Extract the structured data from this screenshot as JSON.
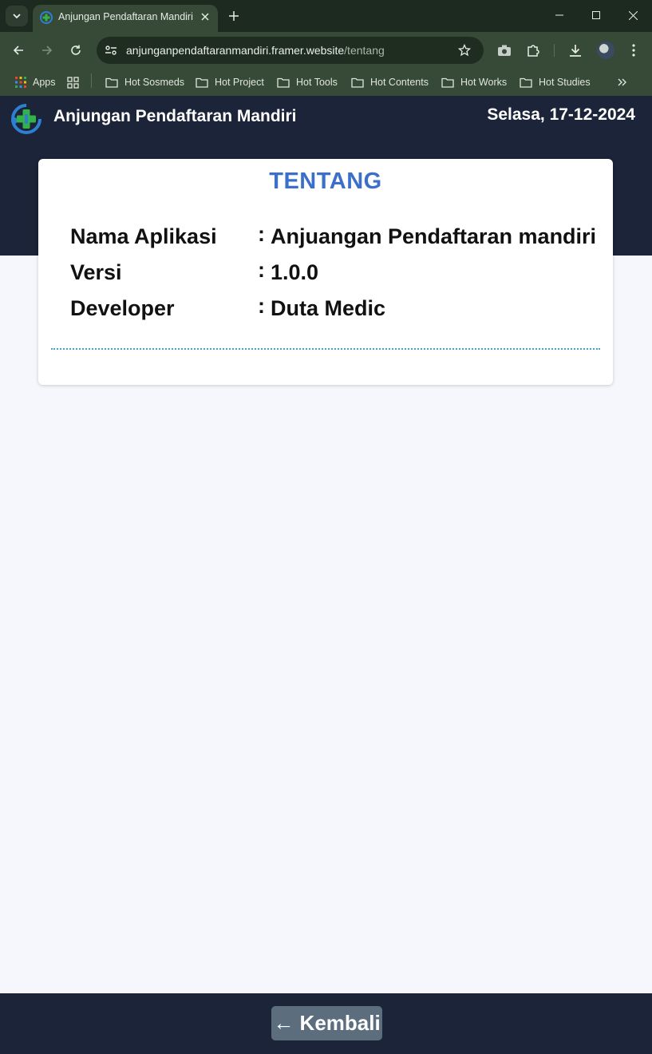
{
  "browser": {
    "tab_title": "Anjungan Pendaftaran Mandiri",
    "url_host": "anjunganpendaftaranmandiri.framer.website",
    "url_path": "/tentang",
    "bookmarks": [
      {
        "label": "Apps",
        "icon": "apps-grid-icon"
      },
      {
        "label": "Hot Sosmeds",
        "icon": "folder-icon"
      },
      {
        "label": "Hot Project",
        "icon": "folder-icon"
      },
      {
        "label": "Hot Tools",
        "icon": "folder-icon"
      },
      {
        "label": "Hot Contents",
        "icon": "folder-icon"
      },
      {
        "label": "Hot Works",
        "icon": "folder-icon"
      },
      {
        "label": "Hot Studies",
        "icon": "folder-icon"
      }
    ]
  },
  "header": {
    "title": "Anjungan Pendaftaran Mandiri",
    "date": "Selasa, 17-12-2024"
  },
  "card": {
    "title": "TENTANG",
    "rows": [
      {
        "label": "Nama Aplikasi",
        "colon": ":",
        "value": "Anjuangan Pendaftaran mandiri"
      },
      {
        "label": "Versi",
        "colon": ":",
        "value": "1.0.0"
      },
      {
        "label": "Developer",
        "colon": ":",
        "value": "Duta Medic"
      }
    ]
  },
  "footer": {
    "back_label": "← Kembali"
  },
  "colors": {
    "header_bg": "#1b2438",
    "card_title": "#3b6fc9",
    "button_bg": "#5c6d7e",
    "divider": "#4ba3c7"
  }
}
